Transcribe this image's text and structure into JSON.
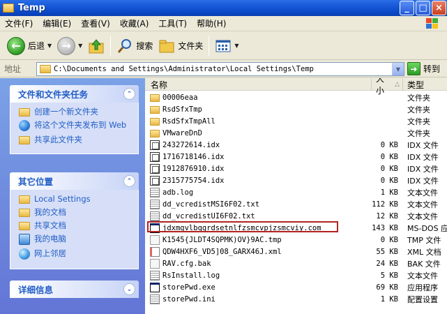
{
  "window": {
    "title": "Temp",
    "buttons": [
      "_",
      "□",
      "×"
    ]
  },
  "menu": [
    "文件(F)",
    "编辑(E)",
    "查看(V)",
    "收藏(A)",
    "工具(T)",
    "帮助(H)"
  ],
  "toolbar": {
    "back_label": "后退",
    "search_label": "搜索",
    "folders_label": "文件夹"
  },
  "address": {
    "label": "地址",
    "path": "C:\\Documents and Settings\\Administrator\\Local Settings\\Temp",
    "go_label": "转到"
  },
  "tasks": {
    "file_tasks": {
      "title": "文件和文件夹任务",
      "items": [
        "创建一个新文件夹",
        "将这个文件夹发布到 Web",
        "共享此文件夹"
      ]
    },
    "other_places": {
      "title": "其它位置",
      "items": [
        "Local Settings",
        "我的文档",
        "共享文档",
        "我的电脑",
        "网上邻居"
      ]
    },
    "details": {
      "title": "详细信息"
    }
  },
  "list": {
    "columns": {
      "name": "名称",
      "size": "大小",
      "type": "类型"
    },
    "files": [
      {
        "name": "00006eaa",
        "size": "",
        "type": "文件夹",
        "icon": "folder"
      },
      {
        "name": "RsdSfxTmp",
        "size": "",
        "type": "文件夹",
        "icon": "folder"
      },
      {
        "name": "RsdSfxTmpAll",
        "size": "",
        "type": "文件夹",
        "icon": "folder"
      },
      {
        "name": "VMwareDnD",
        "size": "",
        "type": "文件夹",
        "icon": "folder"
      },
      {
        "name": "243272614.idx",
        "size": "0 KB",
        "type": "IDX 文件",
        "icon": "idx"
      },
      {
        "name": "1716718146.idx",
        "size": "0 KB",
        "type": "IDX 文件",
        "icon": "idx"
      },
      {
        "name": "1912876910.idx",
        "size": "0 KB",
        "type": "IDX 文件",
        "icon": "idx"
      },
      {
        "name": "2315775754.idx",
        "size": "0 KB",
        "type": "IDX 文件",
        "icon": "idx"
      },
      {
        "name": "adb.log",
        "size": "1 KB",
        "type": "文本文件",
        "icon": "txt"
      },
      {
        "name": "dd_vcredistMSI6F02.txt",
        "size": "112 KB",
        "type": "文本文件",
        "icon": "txt"
      },
      {
        "name": "dd_vcredistUI6F02.txt",
        "size": "12 KB",
        "type": "文本文件",
        "icon": "txt"
      },
      {
        "name": "jdxmgvlbqgrdsetnlfzsmcvpjzsmcviy.com",
        "size": "143 KB",
        "type": "MS-DOS 应用程序",
        "icon": "com"
      },
      {
        "name": "K1545{JLDT4SQPMK)OV}9AC.tmp",
        "size": "0 KB",
        "type": "TMP 文件",
        "icon": "tmp"
      },
      {
        "name": "QDW4HXF6_VD5]08_GARX46J.xml",
        "size": "55 KB",
        "type": "XML 文档",
        "icon": "xml"
      },
      {
        "name": "RAV.cfg.bak",
        "size": "24 KB",
        "type": "BAK 文件",
        "icon": "tmp"
      },
      {
        "name": "RsInstall.log",
        "size": "5 KB",
        "type": "文本文件",
        "icon": "txt"
      },
      {
        "name": "storePwd.exe",
        "size": "69 KB",
        "type": "应用程序",
        "icon": "exe"
      },
      {
        "name": "storePwd.ini",
        "size": "1 KB",
        "type": "配置设置",
        "icon": "txt"
      }
    ]
  }
}
